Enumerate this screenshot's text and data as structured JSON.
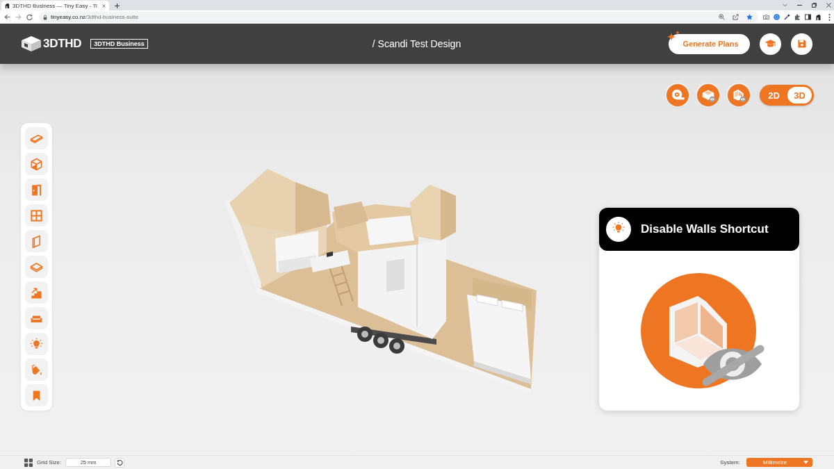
{
  "browser": {
    "tabs": [
      {
        "title": "3DTHD Business — Tiny Easy - Ti",
        "selected": true
      }
    ],
    "url": {
      "host": "tinyeasy.co.nz",
      "path": "/3dthd-business-suite"
    }
  },
  "header": {
    "logo": "3DTHD",
    "badge": "3DTHD Business",
    "title": "/ Scandi Test Design",
    "generate_button": "Generate Plans"
  },
  "view_toggle": [
    {
      "label": "2D",
      "selected": false
    },
    {
      "label": "3D",
      "selected": true
    }
  ],
  "tooltip": {
    "title": "Disable Walls Shortcut"
  },
  "bottom_bar": {
    "grid_label": "Grid Size:",
    "grid_value": "25 mm",
    "system_label": "System:",
    "system_value": "Millimetre"
  }
}
